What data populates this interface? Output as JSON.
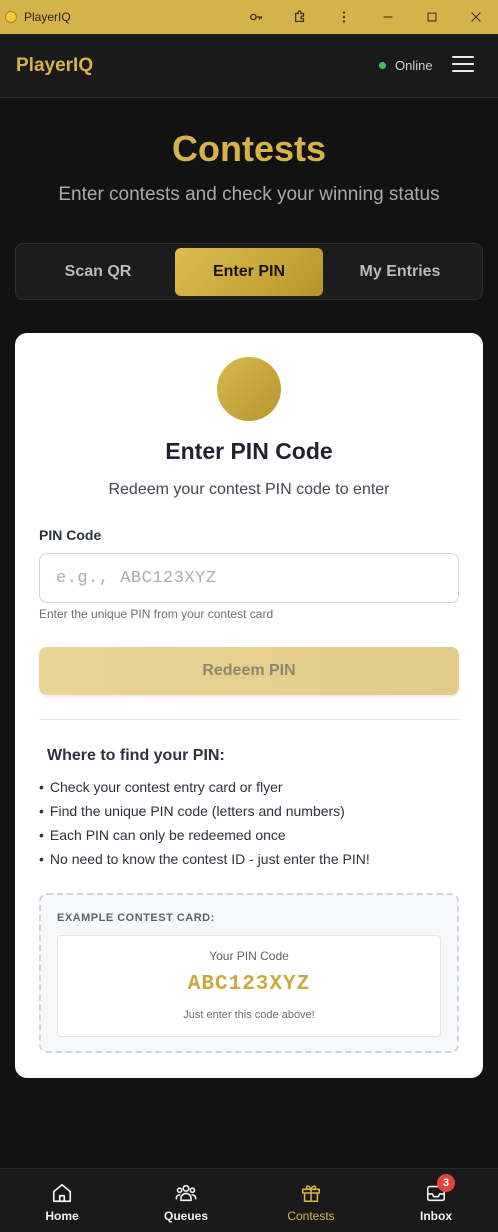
{
  "window": {
    "title": "PlayerIQ",
    "icons": [
      "key-icon",
      "extension-icon",
      "more-vertical-icon",
      "minimize-icon",
      "maximize-icon",
      "close-icon"
    ]
  },
  "header": {
    "brand": "PlayerIQ",
    "status": "Online",
    "status_color": "#4ebe5a",
    "menu_icon": "hamburger-menu-icon"
  },
  "hero": {
    "title": "Contests",
    "subtitle": "Enter contests and check your winning status"
  },
  "tabs": [
    {
      "label": "Scan QR",
      "active": false
    },
    {
      "label": "Enter PIN",
      "active": true
    },
    {
      "label": "My Entries",
      "active": false
    }
  ],
  "card": {
    "title": "Enter PIN Code",
    "description": "Redeem your contest PIN code to enter",
    "field_label": "PIN Code",
    "input_value": "",
    "input_placeholder": "e.g., ABC123XYZ",
    "hint": "Enter the unique PIN from your contest card",
    "button_label": "Redeem PIN",
    "help_title": "Where to find your PIN:",
    "help_items": [
      "Check your contest entry card or flyer",
      "Find the unique PIN code (letters and numbers)",
      "Each PIN can only be redeemed once",
      "No need to know the contest ID - just enter the PIN!"
    ],
    "example": {
      "label": "EXAMPLE CONTEST CARD:",
      "caption": "Your PIN Code",
      "code": "ABC123XYZ",
      "footer": "Just enter this code above!"
    }
  },
  "colors": {
    "accent": "#d4b44a",
    "background": "#121212",
    "card": "#ffffff"
  },
  "bottom_nav": [
    {
      "label": "Home",
      "icon": "home-icon",
      "active": false
    },
    {
      "label": "Queues",
      "icon": "users-icon",
      "active": false
    },
    {
      "label": "Contests",
      "icon": "gift-icon",
      "active": true
    },
    {
      "label": "Inbox",
      "icon": "inbox-icon",
      "active": false,
      "badge": "3"
    }
  ]
}
